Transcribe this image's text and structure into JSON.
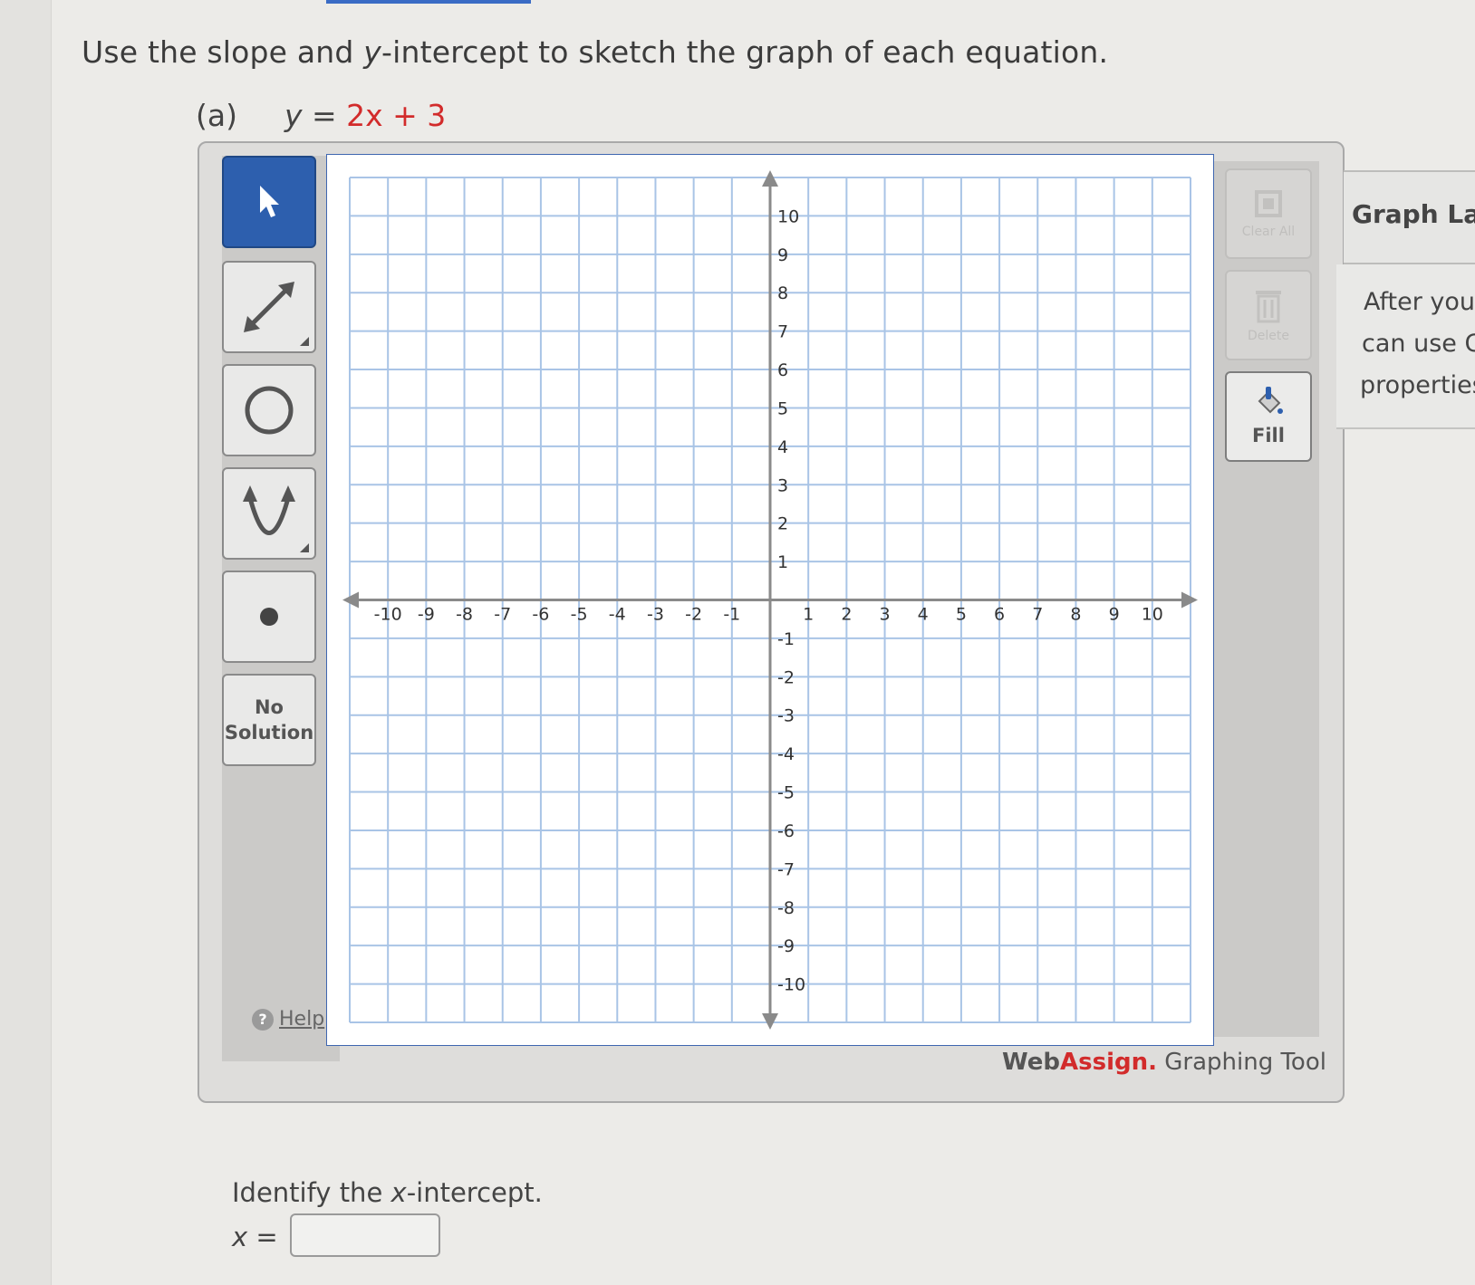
{
  "question": {
    "instruction_prefix": "Use the slope and ",
    "instruction_var": "y",
    "instruction_suffix": "-intercept to sketch the graph of each equation.",
    "part_label": "(a)",
    "equation_lhs": "y",
    "equation_eq": " = ",
    "equation_rhs": "2x + 3"
  },
  "toolbar": {
    "no_solution_line1": "No",
    "no_solution_line2": "Solution",
    "help_label": "Help",
    "help_glyph": "?"
  },
  "right_toolbar": {
    "clear_all_label": "Clear All",
    "delete_label": "Delete",
    "fill_label": "Fill"
  },
  "graph": {
    "xmin": -10,
    "xmax": 10,
    "ymin": -10,
    "ymax": 10,
    "x_ticks": [
      "-10",
      "-9",
      "-8",
      "-7",
      "-6",
      "-5",
      "-4",
      "-3",
      "-2",
      "-1",
      "1",
      "2",
      "3",
      "4",
      "5",
      "6",
      "7",
      "8",
      "9",
      "10"
    ],
    "y_ticks": [
      "10",
      "9",
      "8",
      "7",
      "6",
      "5",
      "4",
      "3",
      "2",
      "1",
      "-1",
      "-2",
      "-3",
      "-4",
      "-5",
      "-6",
      "-7",
      "-8",
      "-9",
      "-10"
    ],
    "grid_color": "#a9c4e6",
    "axis_color": "#8a8a8a"
  },
  "branding": {
    "web": "Web",
    "assign": "Assign.",
    "rest": " Graphing Tool"
  },
  "side_panel": {
    "title": "Graph Lay",
    "line1": "After you",
    "line2": "can use G",
    "line3": "properties"
  },
  "answer": {
    "prompt_prefix": "Identify the ",
    "prompt_var": "x",
    "prompt_suffix": "-intercept.",
    "x_label": "x",
    "eq_sign": " =",
    "value": ""
  },
  "colors": {
    "accent": "#2d5fae",
    "brand_red": "#d22b2b"
  }
}
